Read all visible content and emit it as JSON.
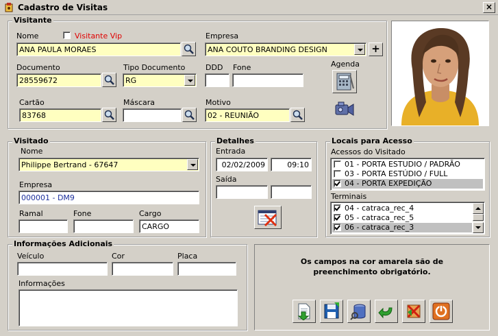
{
  "window": {
    "title": "Cadastro de Visitas"
  },
  "colors": {
    "required_bg": "#ffffc0",
    "vip_label": "#e00000",
    "link_text": "#1c2f9c",
    "face": "#d4d0c8"
  },
  "visitante": {
    "legend": "Visitante",
    "nome_label": "Nome",
    "nome_value": "ANA PAULA MORAES",
    "vip_label": "Visitante Vip",
    "vip_checked": false,
    "empresa_label": "Empresa",
    "empresa_value": "ANA COUTO BRANDING DESIGN",
    "documento_label": "Documento",
    "documento_value": "28559672",
    "tipo_doc_label": "Tipo Documento",
    "tipo_doc_value": "RG",
    "ddd_label": "DDD",
    "ddd_value": "",
    "fone_label": "Fone",
    "fone_value": "",
    "agenda_label": "Agenda",
    "cartao_label": "Cartão",
    "cartao_value": "83768",
    "mascara_label": "Máscara",
    "mascara_value": "",
    "motivo_label": "Motivo",
    "motivo_value": "02 - REUNIÃO",
    "add_label": "+"
  },
  "visitado": {
    "legend": "Visitado",
    "nome_label": "Nome",
    "nome_value": "Philippe Bertrand - 67647",
    "empresa_label": "Empresa",
    "empresa_value": "000001 - DM9",
    "ramal_label": "Ramal",
    "ramal_value": "",
    "fone_label": "Fone",
    "fone_value": "",
    "cargo_label": "Cargo",
    "cargo_value": "CARGO"
  },
  "detalhes": {
    "legend": "Detalhes",
    "entrada_label": "Entrada",
    "entrada_date": "02/02/2009",
    "entrada_time": "09:10",
    "saida_label": "Saída",
    "saida_date": "",
    "saida_time": ""
  },
  "locais": {
    "legend": "Locais para Acesso",
    "acessos_label": "Acessos do Visitado",
    "acessos": [
      {
        "label": "01 - PORTA ESTUDIO  / PADRÃO",
        "checked": false,
        "selected": false
      },
      {
        "label": "03 - PORTA ESTÚDIO / FULL",
        "checked": false,
        "selected": false
      },
      {
        "label": "04 - PORTA EXPEDIÇÃO",
        "checked": true,
        "selected": true
      }
    ],
    "terminais_label": "Terminais",
    "terminais": [
      {
        "label": "04 - catraca_rec_4",
        "checked": true,
        "selected": false
      },
      {
        "label": "05 - catraca_rec_5",
        "checked": true,
        "selected": false
      },
      {
        "label": "06 - catraca_rec_3",
        "checked": true,
        "selected": true
      }
    ]
  },
  "info": {
    "legend": "Informações Adicionais",
    "veiculo_label": "Veículo",
    "veiculo_value": "",
    "cor_label": "Cor",
    "cor_value": "",
    "placa_label": "Placa",
    "placa_value": "",
    "informacoes_label": "Informações",
    "informacoes_value": ""
  },
  "notice": {
    "line1": "Os campos na cor amarela são de",
    "line2": "preenchimento obrigatório."
  },
  "icons": {
    "search": "magnifier-icon",
    "agenda": "calculator-icon",
    "camera": "camera-icon",
    "clear": "clear-form-icon",
    "new": "new-document-icon",
    "save": "floppy-disk-icon",
    "db": "database-icon",
    "back": "back-arrow-icon",
    "delete": "delete-icon",
    "exit": "power-icon"
  }
}
